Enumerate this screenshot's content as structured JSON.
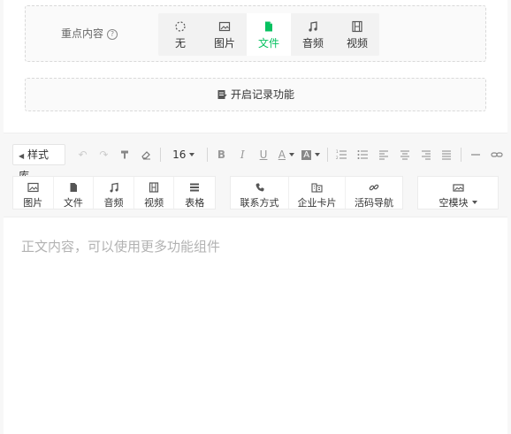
{
  "key_content": {
    "label": "重点内容",
    "help_icon": "question-circle-icon",
    "options": [
      {
        "label": "无",
        "icon": "dashed-circle-icon",
        "selected": false
      },
      {
        "label": "图片",
        "icon": "image-icon",
        "selected": false
      },
      {
        "label": "文件",
        "icon": "file-icon",
        "selected": true
      },
      {
        "label": "音频",
        "icon": "music-icon",
        "selected": false
      },
      {
        "label": "视频",
        "icon": "film-icon",
        "selected": false
      }
    ]
  },
  "record": {
    "label": "开启记录功能",
    "icon": "record-doc-icon"
  },
  "toolbar": {
    "style_lib": "样式库",
    "font_size": "16",
    "tools": [
      "undo-icon",
      "redo-icon",
      "format-painter-icon",
      "eraser-icon",
      "bold-icon",
      "italic-icon",
      "underline-icon",
      "font-color-icon",
      "background-color-icon",
      "ordered-list-icon",
      "unordered-list-icon",
      "align-left-icon",
      "align-center-icon",
      "align-right-icon",
      "justify-icon",
      "horizontal-rule-icon",
      "link-icon"
    ]
  },
  "insert_groups": {
    "media": [
      {
        "label": "图片",
        "icon": "image-icon"
      },
      {
        "label": "文件",
        "icon": "file-icon"
      },
      {
        "label": "音频",
        "icon": "music-icon"
      },
      {
        "label": "视频",
        "icon": "film-icon"
      },
      {
        "label": "表格",
        "icon": "table-icon"
      }
    ],
    "business": [
      {
        "label": "联系方式",
        "icon": "phone-icon"
      },
      {
        "label": "企业卡片",
        "icon": "building-icon"
      },
      {
        "label": "活码导航",
        "icon": "link-chain-icon"
      }
    ],
    "empty_module": {
      "label": "空模块",
      "icon": "empty-module-icon"
    }
  },
  "editor": {
    "placeholder": "正文内容，可以使用更多功能组件"
  },
  "colors": {
    "accent": "#07c160",
    "muted": "#999999",
    "border": "#d9d9d9"
  }
}
